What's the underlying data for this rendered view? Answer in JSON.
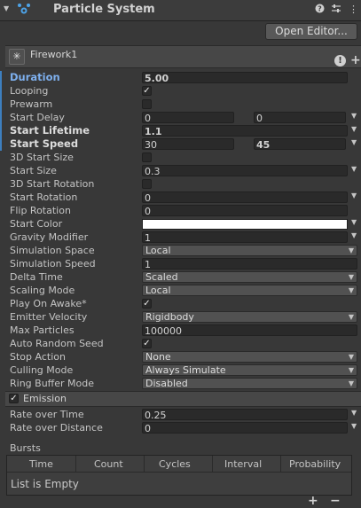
{
  "header": {
    "title": "Particle System"
  },
  "toolbar": {
    "open_editor": "Open Editor..."
  },
  "system": {
    "name": "Firework1"
  },
  "main": {
    "duration": {
      "label": "Duration",
      "value": "5.00"
    },
    "looping": {
      "label": "Looping",
      "checked": true
    },
    "prewarm": {
      "label": "Prewarm",
      "checked": false
    },
    "start_delay": {
      "label": "Start Delay",
      "min": "0",
      "max": "0"
    },
    "start_lifetime": {
      "label": "Start Lifetime",
      "value": "1.1"
    },
    "start_speed": {
      "label": "Start Speed",
      "min": "30",
      "max": "45"
    },
    "start_size_3d": {
      "label": "3D Start Size",
      "checked": false
    },
    "start_size": {
      "label": "Start Size",
      "value": "0.3"
    },
    "start_rotation_3d": {
      "label": "3D Start Rotation",
      "checked": false
    },
    "start_rotation": {
      "label": "Start Rotation",
      "value": "0"
    },
    "flip_rotation": {
      "label": "Flip Rotation",
      "value": "0"
    },
    "start_color": {
      "label": "Start Color",
      "color": "#ffffff"
    },
    "gravity_modifier": {
      "label": "Gravity Modifier",
      "value": "1"
    },
    "simulation_space": {
      "label": "Simulation Space",
      "value": "Local"
    },
    "simulation_speed": {
      "label": "Simulation Speed",
      "value": "1"
    },
    "delta_time": {
      "label": "Delta Time",
      "value": "Scaled"
    },
    "scaling_mode": {
      "label": "Scaling Mode",
      "value": "Local"
    },
    "play_on_awake": {
      "label": "Play On Awake*",
      "checked": true
    },
    "emitter_velocity": {
      "label": "Emitter Velocity",
      "value": "Rigidbody"
    },
    "max_particles": {
      "label": "Max Particles",
      "value": "100000"
    },
    "auto_random_seed": {
      "label": "Auto Random Seed",
      "checked": true
    },
    "stop_action": {
      "label": "Stop Action",
      "value": "None"
    },
    "culling_mode": {
      "label": "Culling Mode",
      "value": "Always Simulate"
    },
    "ring_buffer_mode": {
      "label": "Ring Buffer Mode",
      "value": "Disabled"
    }
  },
  "emission": {
    "label": "Emission",
    "enabled": true,
    "rate_over_time": {
      "label": "Rate over Time",
      "value": "0.25"
    },
    "rate_over_distance": {
      "label": "Rate over Distance",
      "value": "0"
    },
    "bursts": {
      "label": "Bursts",
      "columns": [
        "Time",
        "Count",
        "Cycles",
        "Interval",
        "Probability"
      ],
      "empty_text": "List is Empty"
    }
  },
  "colors": {
    "accent": "#3d7fbf",
    "bg": "#383838",
    "field": "#2a2a2a"
  }
}
